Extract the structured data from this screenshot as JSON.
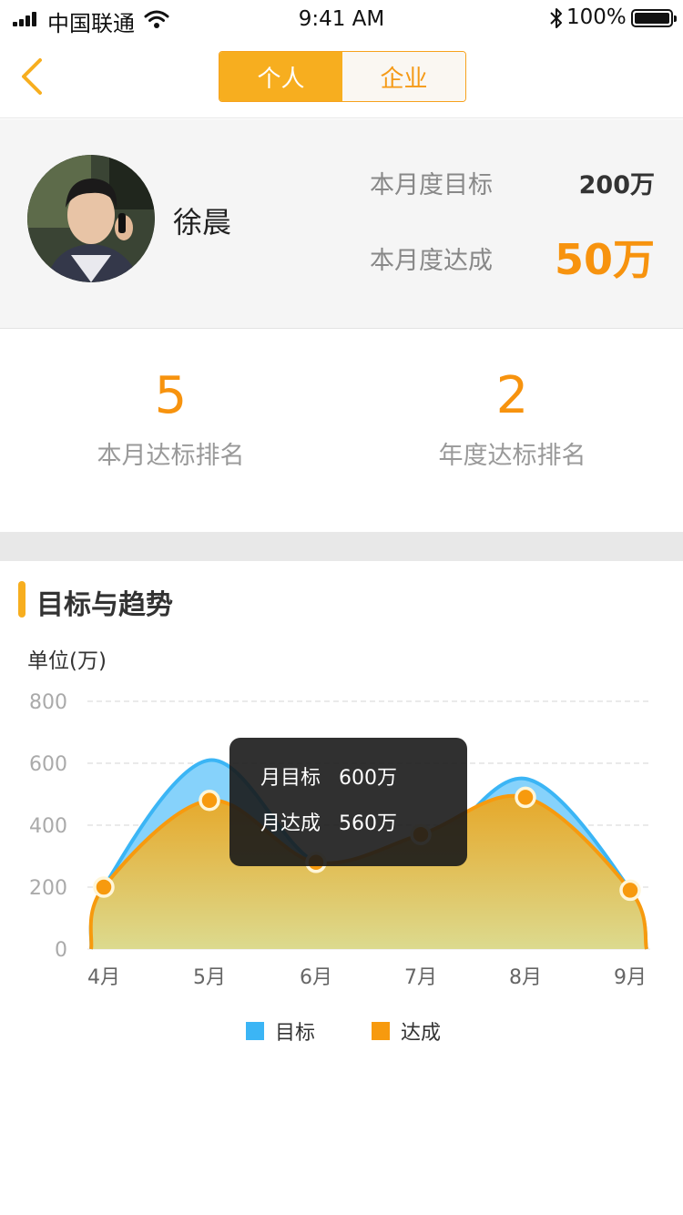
{
  "status_bar": {
    "carrier": "中国联通",
    "time": "9:41 AM",
    "battery": "100%"
  },
  "nav": {
    "back_icon": "chevron-left-icon",
    "segments": [
      {
        "label": "个人",
        "active": true
      },
      {
        "label": "企业",
        "active": false
      }
    ]
  },
  "profile": {
    "name": "徐晨",
    "monthly_target_label": "本月度目标",
    "monthly_target_value": "200万",
    "monthly_achieved_label": "本月度达成",
    "monthly_achieved_value": "50万"
  },
  "rankings": {
    "month": {
      "value": "5",
      "label": "本月达标排名"
    },
    "year": {
      "value": "2",
      "label": "年度达标排名"
    }
  },
  "section": {
    "title": "目标与趋势",
    "unit": "单位(万)"
  },
  "tooltip": {
    "target_label": "月目标",
    "target_value": "600万",
    "achieved_label": "月达成",
    "achieved_value": "560万"
  },
  "legend": {
    "target": "目标",
    "achieved": "达成"
  },
  "colors": {
    "accent": "#f7ae1f",
    "orange": "#f7930e",
    "target_blue": "#3bb5f5",
    "achieved_orange": "#f79a0e"
  },
  "chart_data": {
    "type": "area",
    "categories": [
      "4月",
      "5月",
      "6月",
      "7月",
      "8月",
      "9月"
    ],
    "y_ticks": [
      0,
      200,
      400,
      600,
      800
    ],
    "ylim": [
      0,
      800
    ],
    "series": [
      {
        "name": "目标",
        "values": [
          200,
          610,
          280,
          300,
          550,
          190
        ]
      },
      {
        "name": "达成",
        "values": [
          200,
          480,
          280,
          370,
          490,
          190
        ]
      }
    ],
    "grid": true,
    "legend": "bottom"
  }
}
